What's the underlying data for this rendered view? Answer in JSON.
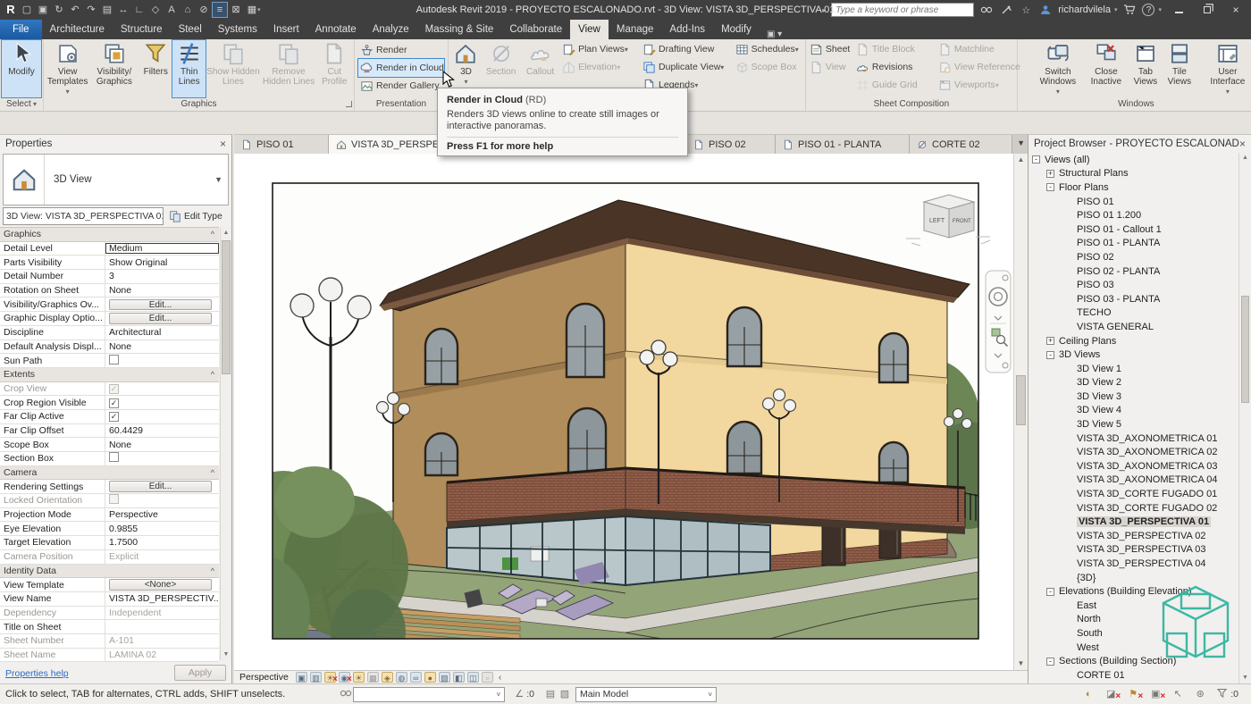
{
  "titlebar": {
    "title": "Autodesk Revit 2019 - PROYECTO ESCALONADO.rvt - 3D View: VISTA 3D_PERSPECTIVA 01",
    "search_placeholder": "Type a keyword or phrase",
    "user": "richardvilela",
    "qat": [
      {
        "name": "revit-menu-icon",
        "g": "R",
        "cls": "qr"
      },
      {
        "name": "open-icon",
        "g": "▢"
      },
      {
        "name": "save-icon",
        "g": "▣"
      },
      {
        "name": "sync-icon",
        "g": "↻"
      },
      {
        "name": "undo-icon",
        "g": "↶"
      },
      {
        "name": "redo-icon",
        "g": "↷"
      },
      {
        "name": "print-icon",
        "g": "▤"
      },
      {
        "name": "measure-icon",
        "g": "↔"
      },
      {
        "name": "aligned-dimension-icon",
        "g": "∟"
      },
      {
        "name": "tag-icon",
        "g": "◇"
      },
      {
        "name": "text-icon",
        "g": "A"
      },
      {
        "name": "default-3d-view-icon",
        "g": "⌂"
      },
      {
        "name": "section-icon",
        "g": "⊘"
      },
      {
        "name": "thin-lines-icon",
        "g": "≡",
        "cls": "qactive"
      },
      {
        "name": "close-hidden-windows-icon",
        "g": "⊠"
      },
      {
        "name": "switch-windows-icon",
        "g": "▦"
      }
    ]
  },
  "ribbon": {
    "file_tab": "File",
    "tabs": [
      "Architecture",
      "Structure",
      "Steel",
      "Systems",
      "Insert",
      "Annotate",
      "Analyze",
      "Massing & Site",
      "Collaborate",
      "View",
      "Manage",
      "Add-Ins",
      "Modify"
    ],
    "active_tab": "View",
    "select": {
      "modify": "Modify",
      "label": "Select"
    },
    "graphics": {
      "label": "Graphics",
      "view_templates": "View Templates",
      "vis_graphics": "Visibility/ Graphics",
      "filters": "Filters",
      "thin_lines": "Thin Lines",
      "show_hidden": "Show Hidden Lines",
      "remove_hidden": "Remove Hidden Lines",
      "cut_profile": "Cut Profile"
    },
    "presentation": {
      "label": "Presentation",
      "render": "Render",
      "render_cloud": "Render in Cloud",
      "render_gallery": "Render Gallery"
    },
    "create": {
      "three_d": "3D",
      "section": "Section",
      "callout": "Callout",
      "plan_views": "Plan Views",
      "elevation": "Elevation",
      "drafting_view": "Drafting View",
      "duplicate_view": "Duplicate View",
      "legends": "Legends",
      "schedules": "Schedules",
      "scope_box": "Scope Box"
    },
    "sheet_composition": {
      "label": "Sheet Composition",
      "sheet": "Sheet",
      "view": "View",
      "title_block": "Title Block",
      "revisions": "Revisions",
      "matchline": "Matchline",
      "view_reference": "View Reference",
      "guide_grid": "Guide Grid",
      "viewports": "Viewports"
    },
    "windows": {
      "label": "Windows",
      "switch_windows": "Switch Windows",
      "close_inactive": "Close Inactive",
      "tab_views": "Tab Views",
      "tile_views": "Tile Views",
      "user_interface": "User Interface"
    }
  },
  "tooltip": {
    "title": "Render in Cloud",
    "shortcut": "(RD)",
    "body": "Renders 3D views online to create still images or interactive panoramas.",
    "footer": "Press F1 for more help"
  },
  "view_tabs": [
    "PISO 01",
    "VISTA 3D_PERSPE",
    "PISO 02",
    "PISO 01 - PLANTA",
    "CORTE 02"
  ],
  "properties": {
    "title": "Properties",
    "type_label": "3D View",
    "selector": "3D View: VISTA 3D_PERSPECTIVA 01",
    "edit_type": "Edit Type",
    "help": "Properties help",
    "apply": "Apply",
    "rows": [
      {
        "label": "Graphics",
        "cls": "hdr"
      },
      {
        "label": "Detail Level",
        "value": "Medium",
        "vcls": "sel"
      },
      {
        "label": "Parts Visibility",
        "value": "Show Original"
      },
      {
        "label": "Detail Number",
        "value": "3"
      },
      {
        "label": "Rotation on Sheet",
        "value": "None"
      },
      {
        "label": "Visibility/Graphics Ov...",
        "value": "Edit...",
        "vcls": "btn"
      },
      {
        "label": "Graphic Display Optio...",
        "value": "Edit...",
        "vcls": "btn"
      },
      {
        "label": "Discipline",
        "value": "Architectural"
      },
      {
        "label": "Default Analysis Displ...",
        "value": "None"
      },
      {
        "label": "Sun Path",
        "vcls": "chk"
      },
      {
        "label": "Extents",
        "cls": "hdr"
      },
      {
        "label": "Crop View",
        "cls": "dis",
        "vcls": "chk on dis"
      },
      {
        "label": "Crop Region Visible",
        "vcls": "chk on"
      },
      {
        "label": "Far Clip Active",
        "vcls": "chk on"
      },
      {
        "label": "Far Clip Offset",
        "value": "60.4429"
      },
      {
        "label": "Scope Box",
        "value": "None"
      },
      {
        "label": "Section Box",
        "vcls": "chk"
      },
      {
        "label": "Camera",
        "cls": "hdr"
      },
      {
        "label": "Rendering Settings",
        "value": "Edit...",
        "vcls": "btn"
      },
      {
        "label": "Locked Orientation",
        "cls": "dis",
        "vcls": "chk dis"
      },
      {
        "label": "Projection Mode",
        "value": "Perspective"
      },
      {
        "label": "Eye Elevation",
        "value": "0.9855"
      },
      {
        "label": "Target Elevation",
        "value": "1.7500"
      },
      {
        "label": "Camera Position",
        "value": "Explicit",
        "cls": "dis",
        "vcls": "dis"
      },
      {
        "label": "Identity Data",
        "cls": "hdr"
      },
      {
        "label": "View Template",
        "value": "<None>",
        "vcls": "btn"
      },
      {
        "label": "View Name",
        "value": "VISTA 3D_PERSPECTIV..."
      },
      {
        "label": "Dependency",
        "value": "Independent",
        "cls": "dis",
        "vcls": "dis"
      },
      {
        "label": "Title on Sheet",
        "value": ""
      },
      {
        "label": "Sheet Number",
        "value": "A-101",
        "cls": "dis",
        "vcls": "dis"
      },
      {
        "label": "Sheet Name",
        "value": "LAMINA 02",
        "cls": "dis",
        "vcls": "dis"
      }
    ]
  },
  "browser": {
    "title": "Project Browser - PROYECTO ESCALONADO.rvt",
    "items": [
      {
        "t": "-",
        "label": "Views (all)",
        "cls": "i0"
      },
      {
        "t": "+",
        "label": "Structural Plans",
        "cls": "i1"
      },
      {
        "t": "-",
        "label": "Floor Plans",
        "cls": "i1"
      },
      {
        "label": "PISO 01",
        "cls": "i2"
      },
      {
        "label": "PISO 01 1.200",
        "cls": "i2"
      },
      {
        "label": "PISO 01 - Callout 1",
        "cls": "i2"
      },
      {
        "label": "PISO 01 - PLANTA",
        "cls": "i2"
      },
      {
        "label": "PISO 02",
        "cls": "i2"
      },
      {
        "label": "PISO 02 - PLANTA",
        "cls": "i2"
      },
      {
        "label": "PISO 03",
        "cls": "i2"
      },
      {
        "label": "PISO 03 - PLANTA",
        "cls": "i2"
      },
      {
        "label": "TECHO",
        "cls": "i2"
      },
      {
        "label": "VISTA GENERAL",
        "cls": "i2"
      },
      {
        "t": "+",
        "label": "Ceiling Plans",
        "cls": "i1"
      },
      {
        "t": "-",
        "label": "3D Views",
        "cls": "i1"
      },
      {
        "label": "3D View 1",
        "cls": "i2"
      },
      {
        "label": "3D View 2",
        "cls": "i2"
      },
      {
        "label": "3D View 3",
        "cls": "i2"
      },
      {
        "label": "3D View 4",
        "cls": "i2"
      },
      {
        "label": "3D View 5",
        "cls": "i2"
      },
      {
        "label": "VISTA 3D_AXONOMETRICA 01",
        "cls": "i2"
      },
      {
        "label": "VISTA 3D_AXONOMETRICA 02",
        "cls": "i2"
      },
      {
        "label": "VISTA 3D_AXONOMETRICA 03",
        "cls": "i2"
      },
      {
        "label": "VISTA 3D_AXONOMETRICA 04",
        "cls": "i2"
      },
      {
        "label": "VISTA 3D_CORTE FUGADO 01",
        "cls": "i2"
      },
      {
        "label": "VISTA 3D_CORTE FUGADO 02",
        "cls": "i2"
      },
      {
        "label": "VISTA 3D_PERSPECTIVA 01",
        "cls": "i2 selected"
      },
      {
        "label": "VISTA 3D_PERSPECTIVA 02",
        "cls": "i2"
      },
      {
        "label": "VISTA 3D_PERSPECTIVA 03",
        "cls": "i2"
      },
      {
        "label": "VISTA 3D_PERSPECTIVA 04",
        "cls": "i2"
      },
      {
        "label": "{3D}",
        "cls": "i2"
      },
      {
        "t": "-",
        "label": "Elevations (Building Elevation)",
        "cls": "i1"
      },
      {
        "label": "East",
        "cls": "i2"
      },
      {
        "label": "North",
        "cls": "i2"
      },
      {
        "label": "South",
        "cls": "i2"
      },
      {
        "label": "West",
        "cls": "i2"
      },
      {
        "t": "-",
        "label": "Sections (Building Section)",
        "cls": "i1"
      },
      {
        "label": "CORTE 01",
        "cls": "i2"
      }
    ]
  },
  "viewcube": {
    "left": "LEFT",
    "front": "FRONT"
  },
  "viewbar": {
    "label": "Perspective",
    "icons": [
      {
        "name": "visual-style-icon",
        "g": "▣",
        "cls": ""
      },
      {
        "name": "graphic-display-options-icon",
        "g": "▥",
        "cls": ""
      },
      {
        "name": "sun-path-off-icon",
        "g": "☀",
        "cls": "amber xed"
      },
      {
        "name": "shadows-off-icon",
        "g": "◉",
        "cls": "xed"
      },
      {
        "name": "sun-settings-icon",
        "g": "☀",
        "cls": "amber"
      },
      {
        "name": "dialog-disabled-icon",
        "g": "▦",
        "cls": "grey"
      },
      {
        "name": "render-dialog-icon",
        "g": "◈",
        "cls": "amber"
      },
      {
        "name": "locked-view-icon",
        "g": "◍",
        "cls": ""
      },
      {
        "name": "temporary-hide-isolate-icon",
        "g": "∞",
        "cls": ""
      },
      {
        "name": "reveal-hidden-elements-icon",
        "g": "●",
        "cls": "amber"
      },
      {
        "name": "temporary-view-properties-icon",
        "g": "▧",
        "cls": ""
      },
      {
        "name": "show-analytical-model-icon",
        "g": "◧",
        "cls": ""
      },
      {
        "name": "highlight-displacement-icon",
        "g": "◫",
        "cls": ""
      },
      {
        "name": "worksharing-display-icon",
        "g": "▫",
        "cls": "grey"
      }
    ]
  },
  "statusbar": {
    "message": "Click to select, TAB for alternates, CTRL adds, SHIFT unselects.",
    "editable_count": ":0",
    "main_model": "Main Model",
    "filter_count": ":0",
    "right_icons": [
      {
        "name": "worksharing-display-settings-icon",
        "g": "◐",
        "cls": "amber"
      },
      {
        "name": "editable-only-icon",
        "g": "◪",
        "cls": "xed"
      },
      {
        "name": "workset-status-icon",
        "g": "⚑",
        "cls": "amber xed"
      },
      {
        "name": "design-options-icon",
        "g": "▣",
        "cls": "xed"
      },
      {
        "name": "select-toggle-icon",
        "g": "↖",
        "cls": ""
      },
      {
        "name": "exclude-options-icon",
        "g": "⊛",
        "cls": ""
      }
    ]
  },
  "colors": {
    "titlebar": "#3f3f3f",
    "file_tab_blue": "#1b59a0",
    "ribbon_bg": "#e9e6e2",
    "highlight_blue": "#cde2f6",
    "highlight_border": "#4a90c8",
    "selection_grey": "#d8d4cf",
    "grass": "#93a478",
    "wall_left": "#b08d5a",
    "wall_right": "#f2d79e",
    "roof": "#4a3426",
    "brick": "#8f5d49",
    "watermark_teal": "#35b5a0",
    "link_blue": "#2a6cc4"
  }
}
